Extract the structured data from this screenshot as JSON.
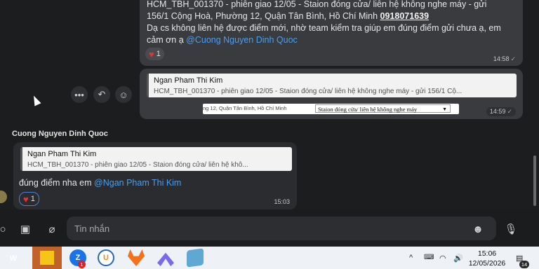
{
  "messages": {
    "outgoing1": {
      "line1": "HCM_TBH_001370 - phiên giao 12/05 - Staion đóng cửa/ liên hệ không nghe máy - gửi",
      "line2_prefix": "156/1 Cộng Hoà, Phường 12, Quận Tân Bình, Hồ Chí Minh",
      "phone": "0918071639",
      "line3": "Dạ cs không liên hệ được điểm mới, nhờ team kiểm tra giúp em đúng điểm gửi chưa ạ, em",
      "line4_prefix": "cảm ơn ạ",
      "mention": "@Cuong Nguyen Dinh Quoc",
      "reaction_count": "1",
      "time": "14:58"
    },
    "outgoing2": {
      "quote_name": "Ngan Pham Thi Kim",
      "quote_text": "HCM_TBH_001370 - phiên giao 12/05 - Staion đóng cửa/ liên hệ không nghe máy - gửi 156/1 Cộ...",
      "image_address": "ng 12, Quận Tân Bình, Hồ Chí Minh",
      "image_select": "Staion đóng cửa/ liên hệ không nghe máy",
      "time": "14:59"
    },
    "incoming1": {
      "sender": "Cuong Nguyen Dinh Quoc",
      "quote_name": "Ngan Pham Thi Kim",
      "quote_text": "HCM_TBH_001370 - phiên giao 12/05 - Staion đóng cửa/ liên hệ khô...",
      "text": "đúng điểm nha em",
      "mention": "@Ngan Pham Thi Kim",
      "reaction_count": "1",
      "time": "15:03"
    }
  },
  "hover_actions": [
    "more-icon",
    "reply-icon",
    "emoji-icon"
  ],
  "composer": {
    "placeholder": "Tin nhắn",
    "icons": [
      "image-icon",
      "attach-icon",
      "emoji-icon",
      "mic-icon"
    ]
  },
  "taskbar": {
    "apps": [
      {
        "name": "wps-office-icon",
        "label": "W",
        "color": "#e8372f"
      },
      {
        "name": "sticky-notes-icon",
        "label": "",
        "color": "#f5c518"
      },
      {
        "name": "zalo-icon",
        "label": "Z",
        "color": "#1a73e8",
        "badge": "1"
      },
      {
        "name": "ultraviewer-icon",
        "label": "U",
        "color": "#ffffff"
      },
      {
        "name": "gitlab-icon",
        "label": "",
        "color": "#f2711c"
      },
      {
        "name": "clickup-icon",
        "label": "",
        "color": "#7b68ee"
      },
      {
        "name": "notepad-icon",
        "label": "",
        "color": "#5fa8d3"
      }
    ],
    "tray_chevron": "^",
    "clock_time": "15:06",
    "clock_date": "12/05/2026",
    "notification_count": "14"
  }
}
